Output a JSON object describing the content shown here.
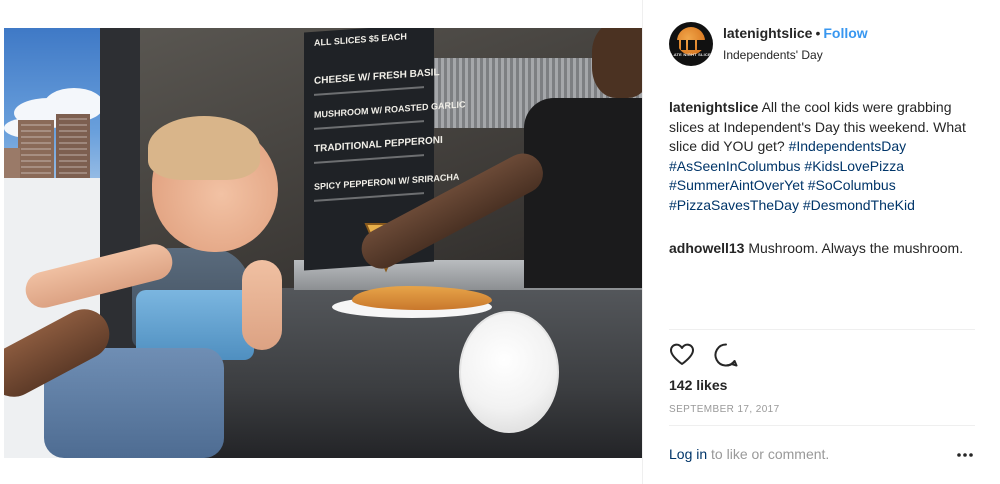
{
  "post": {
    "username": "latenightslice",
    "separator": "•",
    "follow_label": "Follow",
    "location": "Independents' Day",
    "avatar_text": "LATE NIGHT SLICE",
    "caption": {
      "username": "latenightslice",
      "text": "All the cool kids were grabbing slices at Independent's Day this weekend. What slice did YOU get?",
      "hashtags": [
        "#IndependentsDay",
        "#AsSeenInColumbus",
        "#KidsLovePizza",
        "#SummerAintOverYet",
        "#SoColumbus",
        "#PizzaSavesTheDay",
        "#DesmondTheKid"
      ]
    },
    "comment": {
      "username": "adhowell13",
      "text": "Mushroom. Always the mushroom."
    },
    "likes": "142 likes",
    "date": "SEPTEMBER 17, 2017",
    "login_link": "Log in",
    "login_rest": "to like or comment.",
    "icons": [
      "heart-icon",
      "comment-icon",
      "more-options-icon"
    ]
  },
  "photo": {
    "menu_board": {
      "header": "All slices $5 each",
      "items": [
        "Cheese w/ Fresh Basil",
        "Mushroom w/ Roasted Garlic",
        "Traditional Pepperoni",
        "Spicy Pepperoni w/ Sriracha"
      ]
    }
  },
  "colors": {
    "link": "#003569",
    "follow": "#3897f0",
    "text": "#262626",
    "muted": "#999999"
  }
}
